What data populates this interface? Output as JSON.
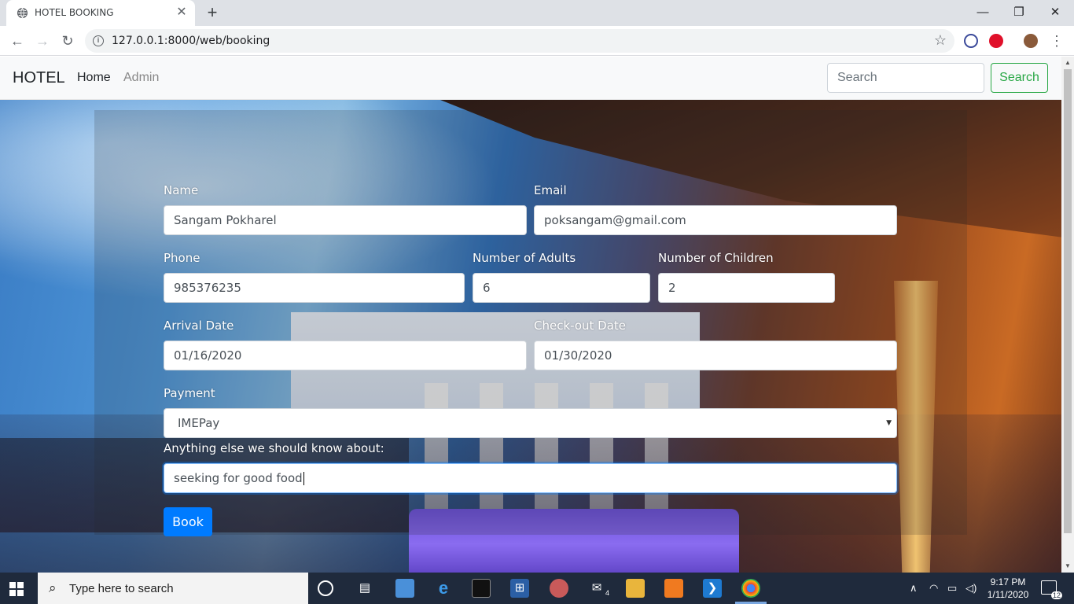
{
  "browser": {
    "tab_title": "HOTEL BOOKING",
    "url": "127.0.0.1:8000/web/booking"
  },
  "navbar": {
    "brand": "HOTEL",
    "links": [
      {
        "label": "Home",
        "active": true
      },
      {
        "label": "Admin",
        "active": false
      }
    ],
    "search_placeholder": "Search",
    "search_button": "Search"
  },
  "form": {
    "name_label": "Name",
    "name_value": "Sangam Pokharel",
    "email_label": "Email",
    "email_value": "poksangam@gmail.com",
    "phone_label": "Phone",
    "phone_value": "985376235",
    "adults_label": "Number of Adults",
    "adults_value": "6",
    "children_label": "Number of Children",
    "children_value": "2",
    "arrival_label": "Arrival Date",
    "arrival_value": "01/16/2020",
    "checkout_label": "Check-out Date",
    "checkout_value": "01/30/2020",
    "payment_label": "Payment",
    "payment_value": "IMEPay",
    "notes_label": "Anything else we should know about:",
    "notes_value": "seeking for good food",
    "submit": "Book"
  },
  "colors": {
    "primary": "#007bff",
    "success": "#28a745"
  },
  "taskbar": {
    "search_placeholder": "Type here to search",
    "time": "9:17 PM",
    "date": "1/11/2020",
    "mail_badge": "4",
    "notif_count": "12"
  }
}
